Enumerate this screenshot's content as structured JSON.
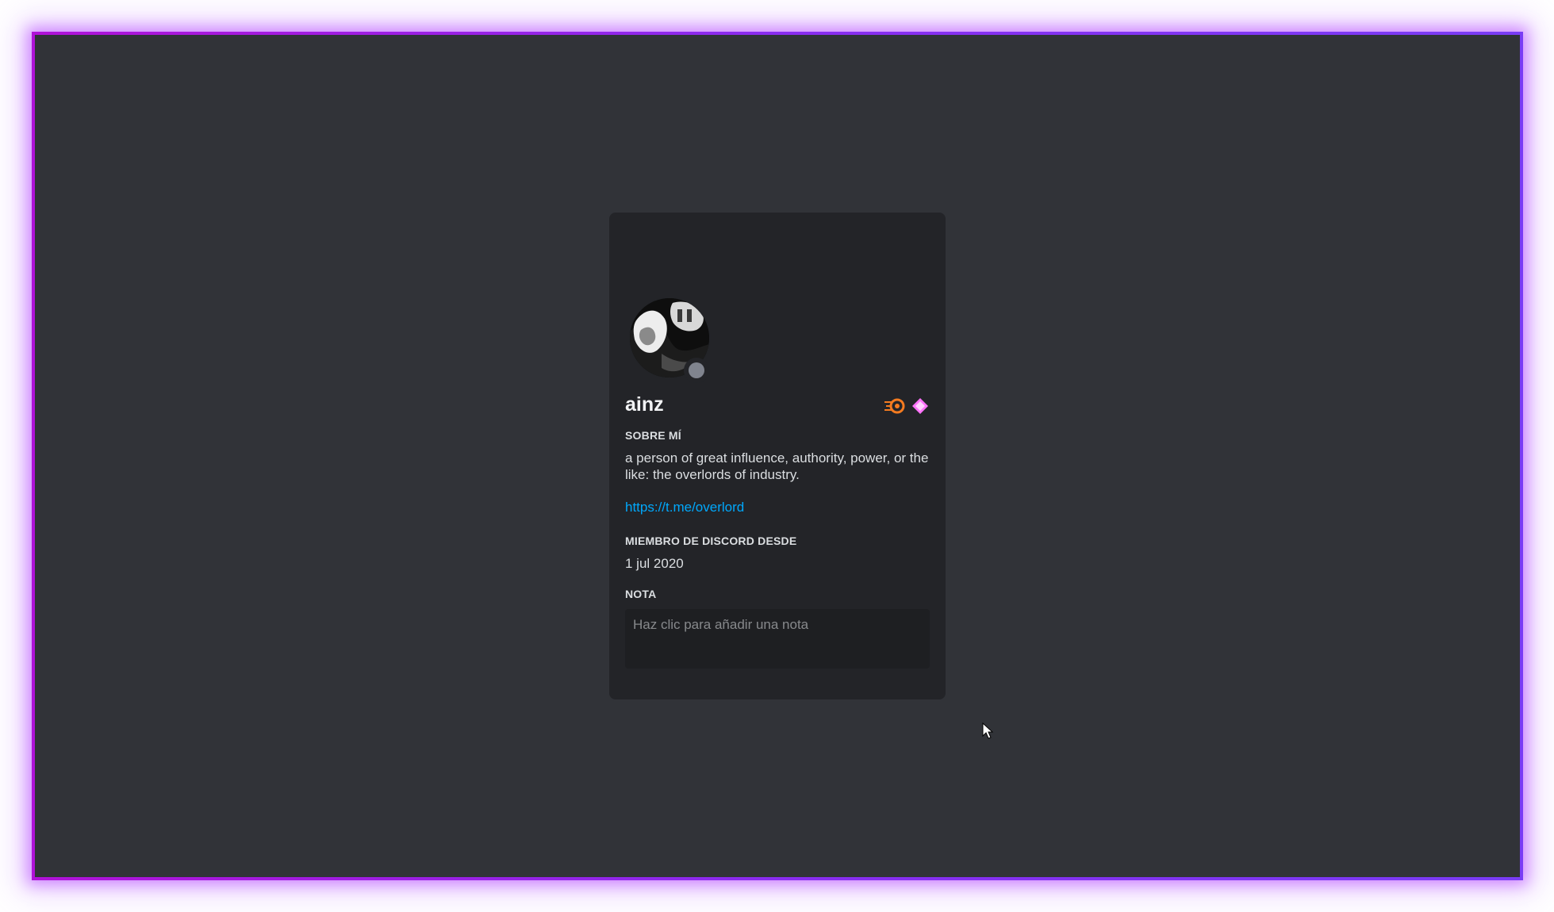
{
  "profile": {
    "username": "ainz",
    "about_label": "SOBRE MÍ",
    "about_text": "a person of great influence, authority, power, or the like: the overlords of industry.",
    "about_link": "https://t.me/overlord",
    "member_since_label": "MIEMBRO DE DISCORD DESDE",
    "member_since_value": "1 jul 2020",
    "note_label": "NOTA",
    "note_placeholder": "Haz clic para añadir una nota",
    "status": "offline",
    "badges": [
      "hypesquad-balance-icon",
      "nitro-diamond-icon"
    ]
  },
  "colors": {
    "frame_accent": "#a012e8",
    "background": "#313338",
    "card": "#232428",
    "link": "#00a8fc",
    "status_offline": "#80848e",
    "badge_orange": "#f47b20",
    "badge_pink": "#ff73fa"
  }
}
